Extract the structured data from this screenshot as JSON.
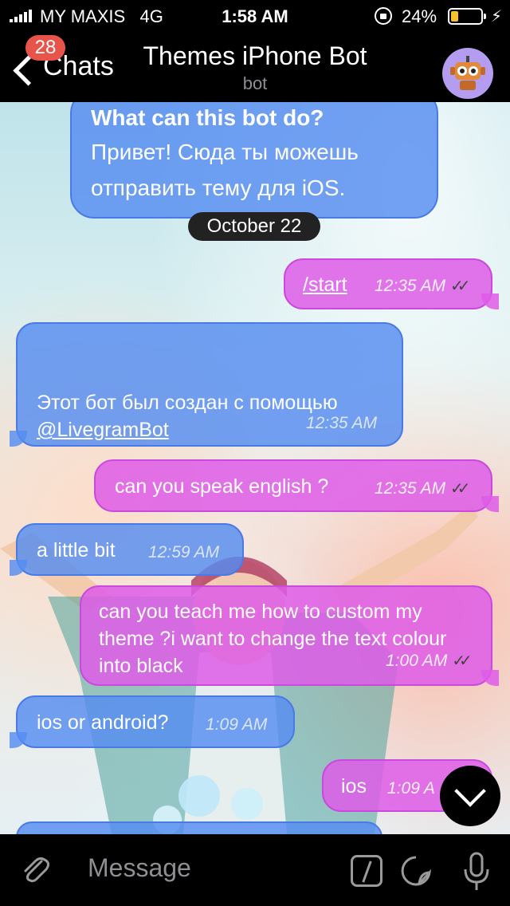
{
  "status_bar": {
    "carrier": "MY MAXIS",
    "network": "4G",
    "time": "1:58 AM",
    "battery": "24%",
    "battery_level": 0.24,
    "icons": [
      "signal-icon",
      "orientation-lock-icon",
      "battery-icon",
      "charging-bolt-icon"
    ]
  },
  "nav": {
    "back_label": "Chats",
    "unread_badge": "28",
    "title": "Themes iPhone Bot",
    "subtitle": "bot"
  },
  "messages": {
    "intro": {
      "title": "What can this bot do?",
      "body": "Привет! Сюда ты можешь отправить тему для iOS."
    },
    "date_separator": "October 22",
    "m1": {
      "text": "/start",
      "time": "12:35 AM"
    },
    "m2": {
      "text": "Этот бот был создан с помощью",
      "link": "@LivegramBot",
      "time": "12:35 AM"
    },
    "m3": {
      "text": "can you speak english ?",
      "time": "12:35 AM"
    },
    "m4": {
      "text": "a little bit",
      "time": "12:59 AM"
    },
    "m5": {
      "text": "can you teach me how to custom my theme ?i want to change the text colour into black",
      "time": "1:00 AM"
    },
    "m6": {
      "text": "ios or android?",
      "time": "1:09 AM"
    },
    "m7": {
      "text": "ios",
      "time": "1:09 A"
    }
  },
  "input": {
    "placeholder": "Message"
  },
  "colors": {
    "incoming_bubble": "#568cf0",
    "outgoing_bubble": "#de5ce8",
    "badge": "#e8544a",
    "battery": "#f7c22a",
    "avatar_bg": "#b49cf0"
  }
}
